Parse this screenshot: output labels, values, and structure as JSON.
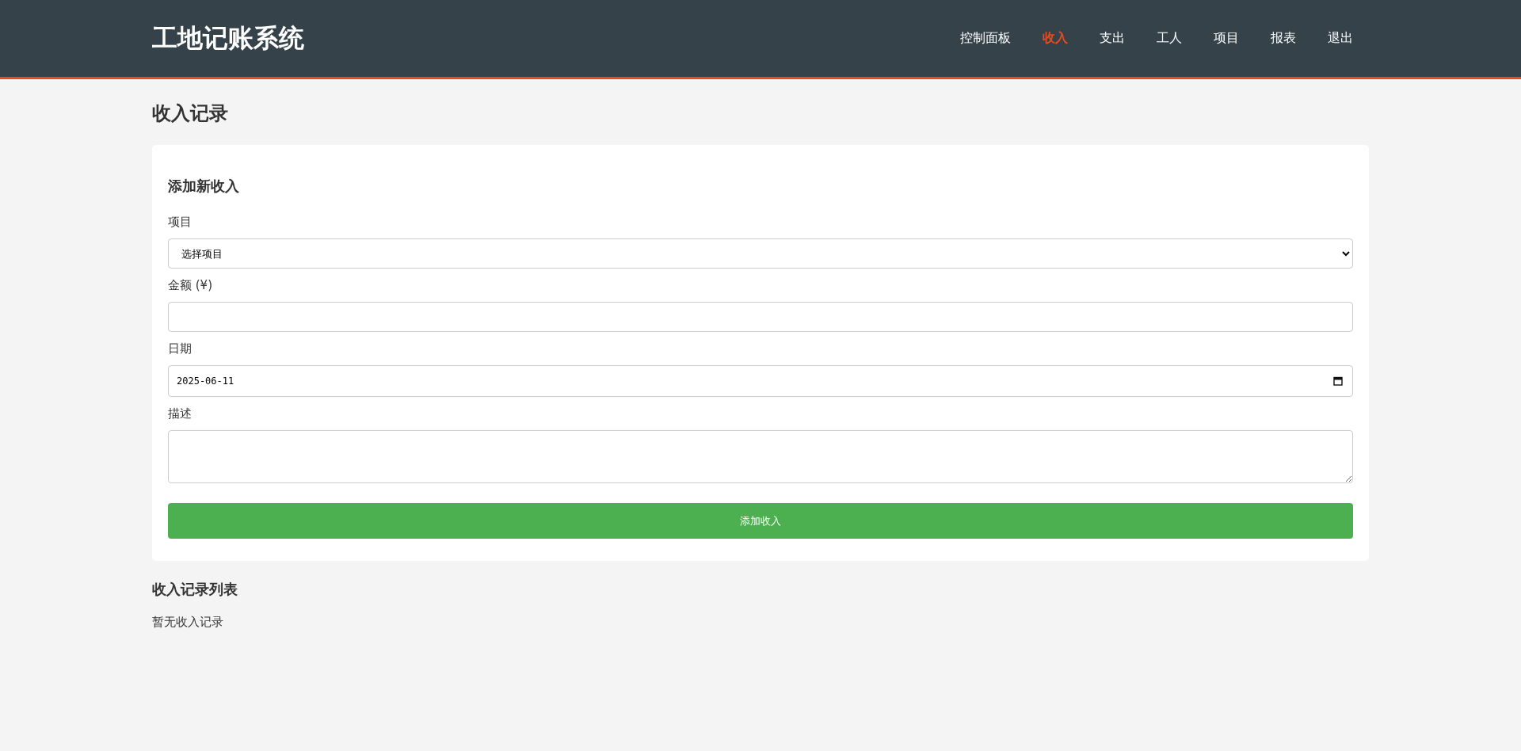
{
  "header": {
    "title": "工地记账系统",
    "nav": [
      {
        "label": "控制面板",
        "selected": false
      },
      {
        "label": "收入",
        "selected": true
      },
      {
        "label": "支出",
        "selected": false
      },
      {
        "label": "工人",
        "selected": false
      },
      {
        "label": "项目",
        "selected": false
      },
      {
        "label": "报表",
        "selected": false
      },
      {
        "label": "退出",
        "selected": false
      }
    ]
  },
  "page_title": "收入记录",
  "form": {
    "title": "添加新收入",
    "fields": [
      {
        "kind": "select",
        "label": "项目",
        "value": "选择项目"
      },
      {
        "kind": "number",
        "label": "金额 (¥)"
      },
      {
        "kind": "date",
        "label": "日期",
        "value": "2025-06-11"
      },
      {
        "kind": "textarea",
        "label": "描述"
      }
    ],
    "submit": "添加收入"
  },
  "list": {
    "title": "收入记录列表",
    "empty_text": "暂无收入记录"
  }
}
